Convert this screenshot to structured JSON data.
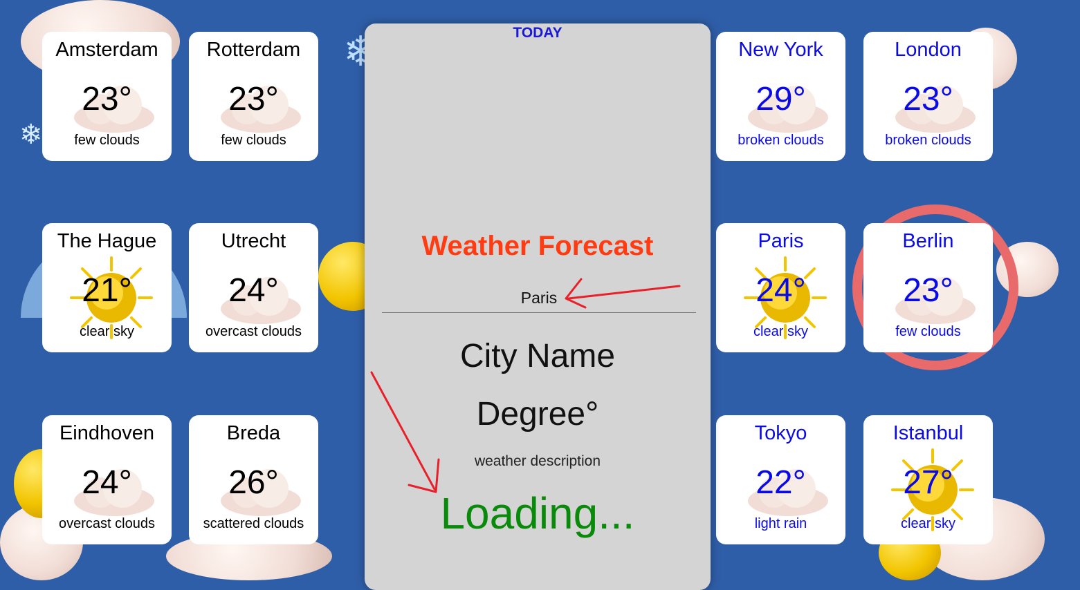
{
  "panel": {
    "today_label": "TODAY",
    "title": "Weather Forecast",
    "search_value": "Paris",
    "city_name": "City Name",
    "degree": "Degree°",
    "description": "weather description",
    "loading": "Loading..."
  },
  "left_cards": [
    {
      "city": "Amsterdam",
      "temp": "23°",
      "desc": "few clouds",
      "icon": "cloud-icon"
    },
    {
      "city": "Rotterdam",
      "temp": "23°",
      "desc": "few clouds",
      "icon": "cloud-icon"
    },
    {
      "city": "The Hague",
      "temp": "21°",
      "desc": "clear sky",
      "icon": "sun-icon"
    },
    {
      "city": "Utrecht",
      "temp": "24°",
      "desc": "overcast clouds",
      "icon": "cloud-icon"
    },
    {
      "city": "Eindhoven",
      "temp": "24°",
      "desc": "overcast clouds",
      "icon": "cloud-icon"
    },
    {
      "city": "Breda",
      "temp": "26°",
      "desc": "scattered clouds",
      "icon": "cloud-icon"
    }
  ],
  "right_cards": [
    {
      "city": "New York",
      "temp": "29°",
      "desc": "broken clouds",
      "icon": "cloud-icon"
    },
    {
      "city": "London",
      "temp": "23°",
      "desc": "broken clouds",
      "icon": "cloud-icon"
    },
    {
      "city": "Paris",
      "temp": "24°",
      "desc": "clear sky",
      "icon": "sun-icon"
    },
    {
      "city": "Berlin",
      "temp": "23°",
      "desc": "few clouds",
      "icon": "cloud-icon"
    },
    {
      "city": "Tokyo",
      "temp": "22°",
      "desc": "light rain",
      "icon": "cloud-icon"
    },
    {
      "city": "Istanbul",
      "temp": "27°",
      "desc": "clear sky",
      "icon": "sun-icon"
    }
  ],
  "colors": {
    "background": "#2f5ea8",
    "panel": "#d4d4d4",
    "title": "#ff3b12",
    "today": "#1a1ad6",
    "loading": "#0a8a0a",
    "right_card_text": "#0a0ae6",
    "annotation_arrow": "#e8202a"
  }
}
